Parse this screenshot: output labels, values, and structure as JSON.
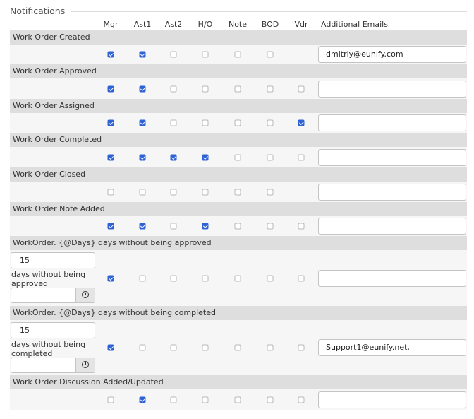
{
  "section": {
    "title": "Notifications"
  },
  "columns": [
    "Mgr",
    "Ast1",
    "Ast2",
    "H/O",
    "Note",
    "BOD",
    "Vdr",
    "Additional Emails"
  ],
  "rows": [
    {
      "label": "Work Order Created",
      "checks": [
        true,
        true,
        false,
        false,
        false,
        false,
        null
      ],
      "email": "dmitriy@eunify.com"
    },
    {
      "label": "Work Order Approved",
      "checks": [
        true,
        true,
        false,
        false,
        false,
        false,
        false
      ],
      "email": ""
    },
    {
      "label": "Work Order Assigned",
      "checks": [
        true,
        true,
        false,
        false,
        false,
        false,
        true
      ],
      "email": ""
    },
    {
      "label": "Work Order Completed",
      "checks": [
        true,
        true,
        true,
        true,
        false,
        false,
        false
      ],
      "email": ""
    },
    {
      "label": "Work Order Closed",
      "checks": [
        false,
        false,
        false,
        false,
        false,
        false,
        null
      ],
      "email": ""
    },
    {
      "label": "Work Order Note Added",
      "checks": [
        true,
        true,
        false,
        true,
        false,
        false,
        false
      ],
      "email": ""
    },
    {
      "label": "WorkOrder. {@Days} days without being approved",
      "days": "15",
      "days_label": "days without being approved",
      "checks": [
        true,
        false,
        false,
        false,
        false,
        false,
        false
      ],
      "email": ""
    },
    {
      "label": "WorkOrder. {@Days} days without being completed",
      "days": "15",
      "days_label": "days without being completed",
      "checks": [
        true,
        false,
        false,
        false,
        false,
        false,
        false
      ],
      "email": "Support1@eunify.net,"
    },
    {
      "label": "Work Order Discussion Added/Updated",
      "checks": [
        false,
        true,
        false,
        false,
        false,
        false,
        false
      ],
      "email": ""
    }
  ],
  "colors": {
    "checked": "#2f62d4",
    "header_band": "#dedede",
    "body_band": "#f6f6f6"
  },
  "icons": {
    "time_picker": "clock-icon"
  }
}
